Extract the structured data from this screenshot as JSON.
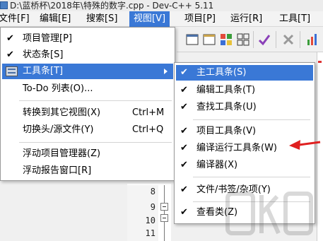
{
  "window": {
    "title": "D:\\蓝桥杯\\2018年\\特殊的数字.cpp - Dev-C++ 5.11"
  },
  "menubar": {
    "items": [
      {
        "label": "文件[F]"
      },
      {
        "label": "编辑[E]"
      },
      {
        "label": "搜索[S]"
      },
      {
        "label": "视图[V]"
      },
      {
        "label": "项目[P]"
      },
      {
        "label": "运行[R]"
      },
      {
        "label": "工具[T]"
      }
    ]
  },
  "view_menu": {
    "items": [
      {
        "label": "项目管理[P]",
        "checked": "✔"
      },
      {
        "label": "状态条[S]",
        "checked": "✔"
      },
      {
        "label": "工具条[T]",
        "icon": "toolbar-icon"
      },
      {
        "label": "To-Do 列表(O)..."
      },
      {
        "label": "转换到其它视图(X)",
        "shortcut": "Ctrl+M"
      },
      {
        "label": "切换头/源文件(Y)",
        "shortcut": "Ctrl+Q"
      },
      {
        "label": "浮动项目管理器(Z)"
      },
      {
        "label": "浮动报告窗口[R]"
      }
    ]
  },
  "toolbars_submenu": {
    "items": [
      {
        "label": "主工具条(S)",
        "checked": "✔"
      },
      {
        "label": "编辑工具条(T)",
        "checked": "✔"
      },
      {
        "label": "查找工具条(U)",
        "checked": "✔"
      },
      {
        "label": "项目工具条(V)",
        "checked": "✔"
      },
      {
        "label": "编译运行工具条(W)",
        "checked": "✔"
      },
      {
        "label": "编译器(X)",
        "checked": "✔"
      },
      {
        "label": "文件/书签/杂项(Y)",
        "checked": "✔"
      },
      {
        "label": "查看类(Z)",
        "checked": "✔"
      }
    ]
  },
  "editor": {
    "line_numbers": [
      "8",
      "9",
      "10",
      "11"
    ]
  },
  "colors": {
    "highlight": "#3a78d6",
    "arrow": "#e02020"
  }
}
